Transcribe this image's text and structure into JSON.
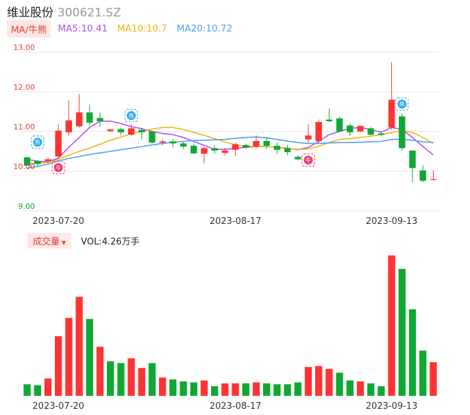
{
  "header": {
    "name": "维业股份",
    "code": "300621.SZ"
  },
  "ma_legend": {
    "tag": "MA/牛熊",
    "items": [
      {
        "label": "MA5:10.41",
        "color": "#b04ef0"
      },
      {
        "label": "MA10:10.7",
        "color": "#f2b30e"
      },
      {
        "label": "MA20:10.72",
        "color": "#4aa0f0"
      }
    ]
  },
  "volume_legend": {
    "tag": "成交量",
    "value": "VOL:4.26万手"
  },
  "colors": {
    "up": "#ff3333",
    "down": "#10a832",
    "grid": "#e6e6e6",
    "axis_text": "#333333",
    "y_tick_text": "#e03c3c"
  },
  "icons": {
    "bull": "牛",
    "bear": "熊"
  },
  "chart_data": [
    {
      "type": "candlestick",
      "y_ticks": [
        "13.00",
        "12.00",
        "11.00",
        "10.00",
        "9.00"
      ],
      "ylim": [
        9.0,
        13.0
      ],
      "x_tick_labels": [
        {
          "label": "2023-07-20",
          "index": 3
        },
        {
          "label": "2023-08-17",
          "index": 20
        },
        {
          "label": "2023-09-13",
          "index": 35
        }
      ],
      "grid": true,
      "candles": [
        {
          "o": 10.35,
          "h": 10.38,
          "l": 10.14,
          "c": 10.14
        },
        {
          "o": 10.26,
          "h": 10.28,
          "l": 10.12,
          "c": 10.18
        },
        {
          "o": 10.26,
          "h": 10.35,
          "l": 10.22,
          "c": 10.3
        },
        {
          "o": 10.37,
          "h": 11.18,
          "l": 10.35,
          "c": 11.02
        },
        {
          "o": 10.98,
          "h": 11.78,
          "l": 10.9,
          "c": 11.28
        },
        {
          "o": 11.13,
          "h": 11.95,
          "l": 11.1,
          "c": 11.48
        },
        {
          "o": 11.48,
          "h": 11.68,
          "l": 11.14,
          "c": 11.22
        },
        {
          "o": 11.34,
          "h": 11.48,
          "l": 11.12,
          "c": 11.26
        },
        {
          "o": 11.01,
          "h": 11.07,
          "l": 10.99,
          "c": 11.05
        },
        {
          "o": 11.06,
          "h": 11.1,
          "l": 10.9,
          "c": 10.98
        },
        {
          "o": 10.92,
          "h": 11.2,
          "l": 10.88,
          "c": 11.08
        },
        {
          "o": 11.04,
          "h": 11.08,
          "l": 10.8,
          "c": 10.98
        },
        {
          "o": 11.0,
          "h": 11.02,
          "l": 10.7,
          "c": 10.72
        },
        {
          "o": 10.72,
          "h": 10.8,
          "l": 10.65,
          "c": 10.75
        },
        {
          "o": 10.75,
          "h": 10.82,
          "l": 10.6,
          "c": 10.7
        },
        {
          "o": 10.7,
          "h": 10.75,
          "l": 10.56,
          "c": 10.62
        },
        {
          "o": 10.64,
          "h": 10.7,
          "l": 10.42,
          "c": 10.45
        },
        {
          "o": 10.44,
          "h": 10.62,
          "l": 10.2,
          "c": 10.58
        },
        {
          "o": 10.58,
          "h": 10.66,
          "l": 10.44,
          "c": 10.52
        },
        {
          "o": 10.46,
          "h": 10.58,
          "l": 10.4,
          "c": 10.52
        },
        {
          "o": 10.54,
          "h": 10.72,
          "l": 10.38,
          "c": 10.68
        },
        {
          "o": 10.66,
          "h": 10.7,
          "l": 10.56,
          "c": 10.6
        },
        {
          "o": 10.62,
          "h": 10.9,
          "l": 10.58,
          "c": 10.76
        },
        {
          "o": 10.76,
          "h": 10.85,
          "l": 10.56,
          "c": 10.64
        },
        {
          "o": 10.64,
          "h": 10.72,
          "l": 10.44,
          "c": 10.54
        },
        {
          "o": 10.58,
          "h": 10.66,
          "l": 10.4,
          "c": 10.48
        },
        {
          "o": 10.36,
          "h": 10.4,
          "l": 10.28,
          "c": 10.3
        },
        {
          "o": 10.8,
          "h": 11.18,
          "l": 10.72,
          "c": 10.9
        },
        {
          "o": 10.76,
          "h": 11.28,
          "l": 10.72,
          "c": 11.24
        },
        {
          "o": 11.3,
          "h": 11.58,
          "l": 11.24,
          "c": 11.26
        },
        {
          "o": 11.33,
          "h": 11.38,
          "l": 10.98,
          "c": 11.0
        },
        {
          "o": 11.15,
          "h": 11.2,
          "l": 10.88,
          "c": 10.98
        },
        {
          "o": 11.0,
          "h": 11.15,
          "l": 10.98,
          "c": 11.14
        },
        {
          "o": 11.08,
          "h": 11.12,
          "l": 10.9,
          "c": 10.92
        },
        {
          "o": 10.95,
          "h": 11.0,
          "l": 10.88,
          "c": 10.92
        },
        {
          "o": 11.1,
          "h": 12.75,
          "l": 11.05,
          "c": 11.8
        },
        {
          "o": 11.38,
          "h": 11.45,
          "l": 10.52,
          "c": 10.58
        },
        {
          "o": 10.52,
          "h": 10.52,
          "l": 9.72,
          "c": 10.08
        },
        {
          "o": 10.02,
          "h": 10.15,
          "l": 9.72,
          "c": 9.76
        },
        {
          "o": 9.78,
          "h": 10.02,
          "l": 9.76,
          "c": 9.8
        }
      ],
      "moving_averages": [
        {
          "name": "MA5",
          "color": "#b04ef0",
          "start": 0,
          "values": [
            10.3,
            10.25,
            10.24,
            10.33,
            10.6,
            10.85,
            11.1,
            11.26,
            11.26,
            11.2,
            11.12,
            11.07,
            11.0,
            10.95,
            10.92,
            10.85,
            10.75,
            10.65,
            10.55,
            10.55,
            10.58,
            10.6,
            10.62,
            10.62,
            10.6,
            10.58,
            10.54,
            10.6,
            10.75,
            10.92,
            11.0,
            11.08,
            11.1,
            11.05,
            10.98,
            11.1,
            11.05,
            10.85,
            10.62,
            10.41
          ]
        },
        {
          "name": "MA10",
          "color": "#f2b30e",
          "start": 0,
          "values": [
            10.2,
            10.2,
            10.22,
            10.3,
            10.4,
            10.5,
            10.58,
            10.68,
            10.78,
            10.86,
            10.94,
            11.0,
            11.06,
            11.1,
            11.1,
            11.05,
            10.98,
            10.9,
            10.82,
            10.74,
            10.66,
            10.63,
            10.62,
            10.62,
            10.6,
            10.57,
            10.55,
            10.56,
            10.63,
            10.72,
            10.8,
            10.82,
            10.85,
            10.88,
            10.92,
            10.97,
            11.02,
            10.98,
            10.85,
            10.7
          ]
        },
        {
          "name": "MA20",
          "color": "#4aa0f0",
          "start": 0,
          "values": [
            10.08,
            10.12,
            10.18,
            10.26,
            10.32,
            10.37,
            10.42,
            10.46,
            10.5,
            10.54,
            10.58,
            10.62,
            10.66,
            10.7,
            10.73,
            10.75,
            10.77,
            10.78,
            10.79,
            10.8,
            10.83,
            10.85,
            10.86,
            10.84,
            10.8,
            10.76,
            10.72,
            10.7,
            10.7,
            10.71,
            10.72,
            10.72,
            10.73,
            10.74,
            10.75,
            10.8,
            10.8,
            10.78,
            10.74,
            10.72
          ]
        }
      ],
      "markers": [
        {
          "kind": "bear",
          "index": 1,
          "value": 10.73
        },
        {
          "kind": "bull",
          "index": 3,
          "value": 10.09
        },
        {
          "kind": "bear",
          "index": 10,
          "value": 11.4
        },
        {
          "kind": "bull",
          "index": 27,
          "value": 10.28
        },
        {
          "kind": "bear",
          "index": 36,
          "value": 11.69
        }
      ]
    },
    {
      "type": "bar",
      "title": "成交量",
      "ylim": [
        0,
        14.6
      ],
      "x_tick_labels": [
        {
          "label": "2023-07-20",
          "index": 3
        },
        {
          "label": "2023-08-17",
          "index": 20
        },
        {
          "label": "2023-09-13",
          "index": 35
        }
      ],
      "values": [
        1.2,
        1.1,
        1.8,
        6.2,
        8.1,
        10.3,
        8.0,
        5.1,
        3.6,
        3.4,
        3.9,
        2.9,
        3.4,
        1.9,
        1.7,
        1.5,
        1.4,
        1.6,
        1.0,
        1.3,
        1.3,
        1.3,
        1.4,
        1.3,
        1.2,
        1.2,
        1.4,
        3.0,
        3.1,
        2.8,
        2.4,
        1.6,
        1.5,
        1.3,
        1.0,
        14.6,
        13.2,
        9.0,
        4.7,
        3.5
      ],
      "directions": [
        "down",
        "down",
        "up",
        "up",
        "up",
        "up",
        "down",
        "up",
        "down",
        "down",
        "up",
        "up",
        "down",
        "up",
        "down",
        "down",
        "down",
        "up",
        "down",
        "up",
        "up",
        "down",
        "up",
        "down",
        "down",
        "down",
        "down",
        "up",
        "up",
        "up",
        "down",
        "down",
        "up",
        "down",
        "down",
        "up",
        "down",
        "down",
        "down",
        "up"
      ]
    }
  ]
}
